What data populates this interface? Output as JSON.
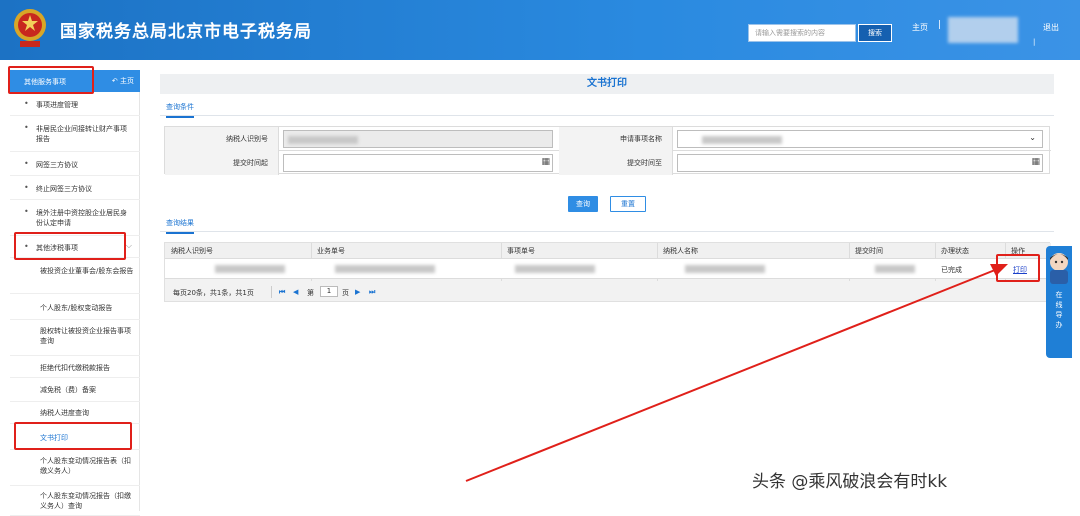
{
  "header": {
    "title": "国家税务总局北京市电子税务局",
    "search_placeholder": "请输入需要搜索的内容",
    "search_button": "搜索",
    "home_link": "主页",
    "separator": "|",
    "logout_link": "退出",
    "bg_color": "#1c72c4"
  },
  "sidebar": {
    "head_label": "其他服务事项",
    "home_label": "主页",
    "items": [
      {
        "label": "事项进度管理"
      },
      {
        "label": "非居民企业间接转让财产事项报告"
      },
      {
        "label": "网签三方协议"
      },
      {
        "label": "终止网签三方协议"
      },
      {
        "label": "境外注册中资控股企业居民身份认定申请"
      },
      {
        "label": "其他涉税事项"
      }
    ],
    "sub_items": [
      {
        "label": "被投资企业董事会/股东会报告"
      },
      {
        "label": "个人股东/股权变动报告"
      },
      {
        "label": "股权转让被投资企业报告事项查询"
      },
      {
        "label": "拒绝代扣代缴税款报告"
      },
      {
        "label": "减免税（费）备案"
      },
      {
        "label": "纳税人进度查询"
      },
      {
        "label": "文书打印"
      },
      {
        "label": "个人股东变动情况报告表（扣缴义务人）"
      },
      {
        "label": "个人股东变动情况报告（扣缴义务人）查询"
      }
    ],
    "active_color": "#1a73d1"
  },
  "main": {
    "page_title": "文书打印",
    "query_section_tab": "查询条件",
    "result_section_tab": "查询结果",
    "form": {
      "taxpayer_id_label": "纳税人识别号",
      "apply_item_label": "申请事项名称",
      "submit_from_label": "提交时间起",
      "submit_to_label": "提交时间至",
      "calendar_glyph": "▦",
      "select_glyph": "⌄"
    },
    "query_button": "查询",
    "reset_button": "重置",
    "grid": {
      "columns": [
        "纳税人识别号",
        "业务单号",
        "事项单号",
        "纳税人名称",
        "提交时间",
        "办理状态",
        "操作"
      ],
      "rows": [
        {
          "status": "已完成",
          "action": "打印"
        }
      ]
    },
    "pager": {
      "summary": "每页20条，共1条，共1页",
      "first": "⏮",
      "prev": "◀",
      "page_prefix": "第",
      "page_value": "1",
      "page_suffix": "页",
      "next": "▶",
      "last": "⏭"
    }
  },
  "float_widget": {
    "text": "在线导办"
  },
  "watermark": "头条 @乘风破浪会有时kk",
  "annotation_color": "#e0201a"
}
